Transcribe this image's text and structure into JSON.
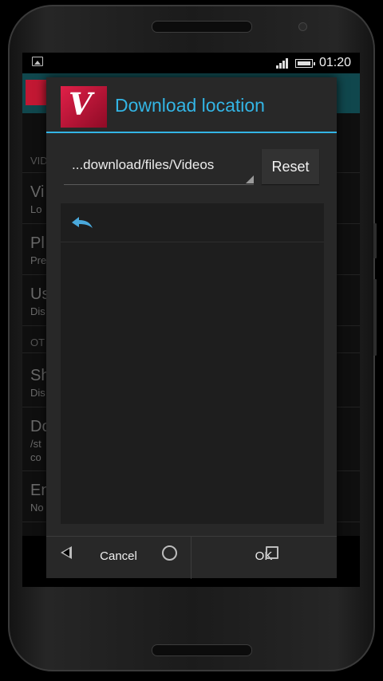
{
  "status_bar": {
    "time": "01:20"
  },
  "dialog": {
    "title": "Download location",
    "path_value": "...download/files/Videos",
    "reset_label": "Reset",
    "cancel_label": "Cancel",
    "ok_label": "OK",
    "up_icon": "back-arrow-icon",
    "logo": "app-logo-icon"
  },
  "background_list": {
    "head_1": "VID",
    "items": [
      {
        "title": "Vi",
        "subtitle": "Lo"
      },
      {
        "title": "Pl",
        "subtitle": "Pre"
      },
      {
        "title": "Us",
        "subtitle": "Dis"
      }
    ],
    "head_2": "OT",
    "items_2": [
      {
        "title": "Sh",
        "subtitle": "Dis"
      },
      {
        "title": "Do",
        "subtitle": "/st",
        "subtitle2": "co"
      },
      {
        "title": "En",
        "subtitle": "No"
      }
    ]
  },
  "colors": {
    "accent": "#33b5e5",
    "appbar": "#10474d",
    "dialog_bg": "#282828",
    "panel_bg": "#1e1e1e"
  },
  "nav_icons": [
    "back-icon",
    "home-icon",
    "recents-icon"
  ]
}
